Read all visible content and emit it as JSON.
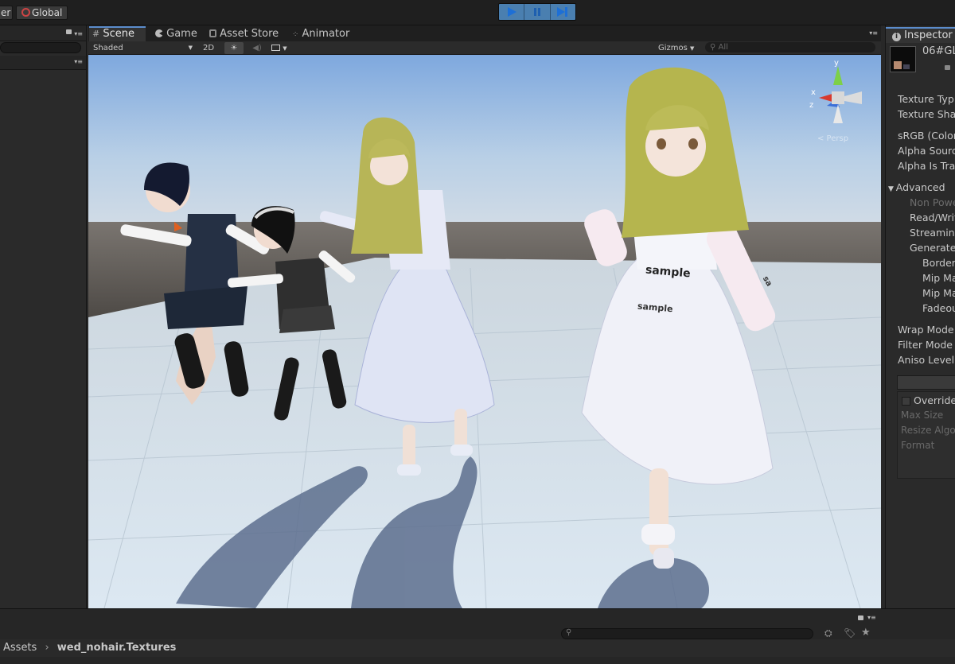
{
  "toolbar": {
    "pivot_label": "er",
    "global_label": "Global",
    "play_icon": "play-icon",
    "pause_icon": "pause-icon",
    "step_icon": "step-icon"
  },
  "tabs": {
    "scene": "Scene",
    "game": "Game",
    "asset_store": "Asset Store",
    "animator": "Animator"
  },
  "scene_bar": {
    "shading_mode": "Shaded",
    "mode_2d": "2D",
    "gizmos": "Gizmos",
    "search_placeholder": "All"
  },
  "viewport": {
    "gizmo_axes": {
      "y": "y",
      "x": "x",
      "z": "z"
    },
    "persp_label": "< Persp",
    "watermark": "sample"
  },
  "inspector": {
    "tab_label": "Inspector",
    "asset_name": "06#GL",
    "rows": [
      {
        "label": "Texture Typ",
        "dim": false
      },
      {
        "label": "Texture Sha",
        "dim": false
      },
      {
        "label": "sRGB (Color",
        "dim": false
      },
      {
        "label": "Alpha Sourc",
        "dim": false
      },
      {
        "label": "Alpha Is Tra",
        "dim": false
      },
      {
        "label": "Advanced",
        "dim": false
      },
      {
        "label": "Non Powe",
        "dim": true
      },
      {
        "label": "Read/Writ",
        "dim": false
      },
      {
        "label": "Streaming",
        "dim": false
      },
      {
        "label": "Generate",
        "dim": false
      },
      {
        "label": "Border",
        "dim": false
      },
      {
        "label": "Mip Map",
        "dim": false
      },
      {
        "label": "Mip Map",
        "dim": false
      },
      {
        "label": "Fadeou",
        "dim": false
      },
      {
        "label": "Wrap Mode",
        "dim": false
      },
      {
        "label": "Filter Mode",
        "dim": false
      },
      {
        "label": "Aniso Level",
        "dim": false
      }
    ],
    "override_label": "Override",
    "platform_rows": [
      "Max Size",
      "Resize Algo",
      "Format"
    ]
  },
  "breadcrumb": {
    "root": "Assets",
    "folder": "wed_nohair.Textures"
  },
  "colors": {
    "play_accent": "#4a7fb0",
    "tab_accent": "#5b8ccc"
  }
}
